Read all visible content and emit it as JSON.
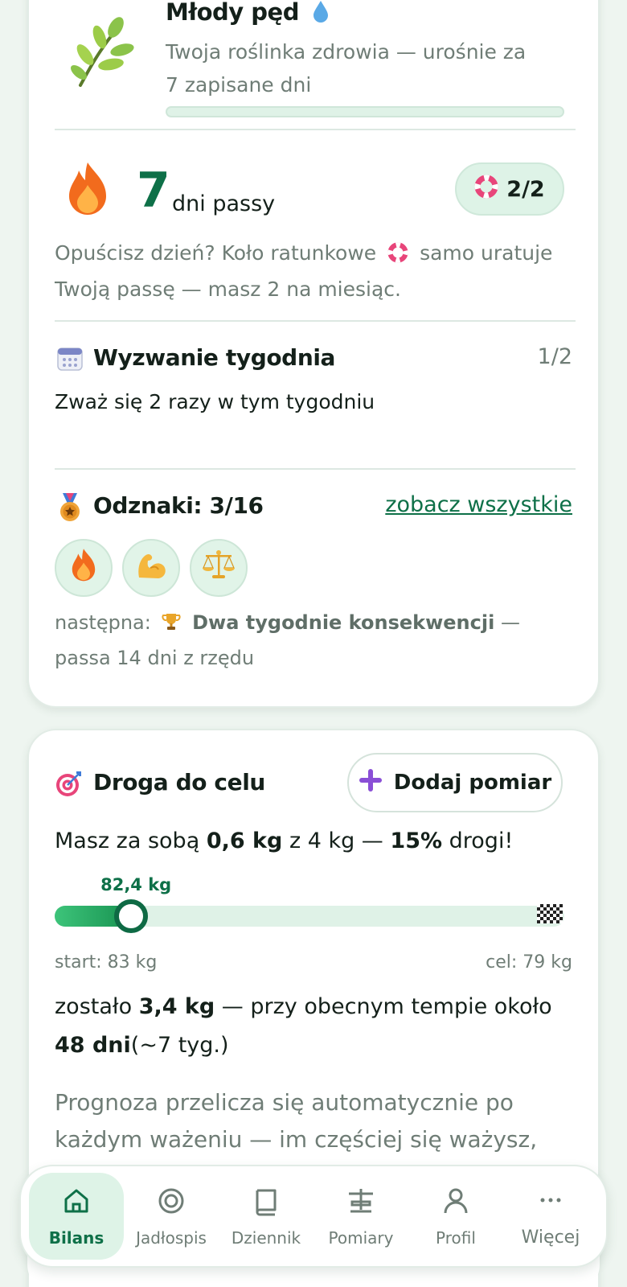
{
  "plant": {
    "title": "Młody pęd",
    "drop_icon": "droplet-icon",
    "description": "Twoja roślinka zdrowia — urośnie za 7 zapisane dni",
    "icon": "sprout-icon"
  },
  "streak": {
    "count": "7",
    "unit": "dni passy",
    "lifebuoys": "2/2",
    "note_before": "Opuścisz dzień? Koło ratunkowe",
    "note_after": "samo uratuje Twoją passę — masz 2 na miesiąc."
  },
  "challenge": {
    "title": "Wyzwanie tygodnia",
    "progress": "1/2",
    "description": "Zważ się 2 razy w tym tygodniu"
  },
  "badges": {
    "title": "Odznaki: 3/16",
    "see_all": "zobacz wszystkie",
    "items": [
      {
        "icon": "fire-icon"
      },
      {
        "icon": "flexed-biceps-icon"
      },
      {
        "icon": "balance-scale-icon"
      }
    ],
    "next_label": "następna:",
    "next_name": "Dwa tygodnie konsekwencji",
    "next_desc": "— passa 14 dni z rzędu"
  },
  "goal": {
    "title": "Droga do celu",
    "add_button": "Dodaj pomiar",
    "summary_prefix": "Masz za sobą",
    "summary_done": "0,6 kg",
    "summary_mid": "z 4 kg —",
    "summary_percent": "15%",
    "summary_suffix": "drogi!",
    "current_label": "82,4 kg",
    "progress_fraction": 0.15,
    "start_label": "start: 83 kg",
    "target_label": "cel: 79 kg",
    "remaining_prefix": "zostało",
    "remaining_value": "3,4 kg",
    "remaining_mid": "— przy obecnym tempie około",
    "remaining_days": "48 dni",
    "remaining_weeks": "(~7 tyg.)",
    "forecast_note": "Prognoza przelicza się automatycznie po każdym ważeniu — im częściej się ważysz, tym"
  },
  "nav": {
    "items": [
      {
        "label": "Bilans",
        "icon": "home-icon",
        "active": true
      },
      {
        "label": "Jadłospis",
        "icon": "target-icon",
        "active": false
      },
      {
        "label": "Dziennik",
        "icon": "book-icon",
        "active": false
      },
      {
        "label": "Pomiary",
        "icon": "scale-icon",
        "active": false
      },
      {
        "label": "Profil",
        "icon": "user-icon",
        "active": false
      },
      {
        "label": "Więcej",
        "icon": "more-dots-icon",
        "active": false
      }
    ]
  },
  "colors": {
    "accent": "#0e7048",
    "accent_light": "#def3e7",
    "muted_text": "#6f7d76",
    "background": "#eef5f0"
  }
}
